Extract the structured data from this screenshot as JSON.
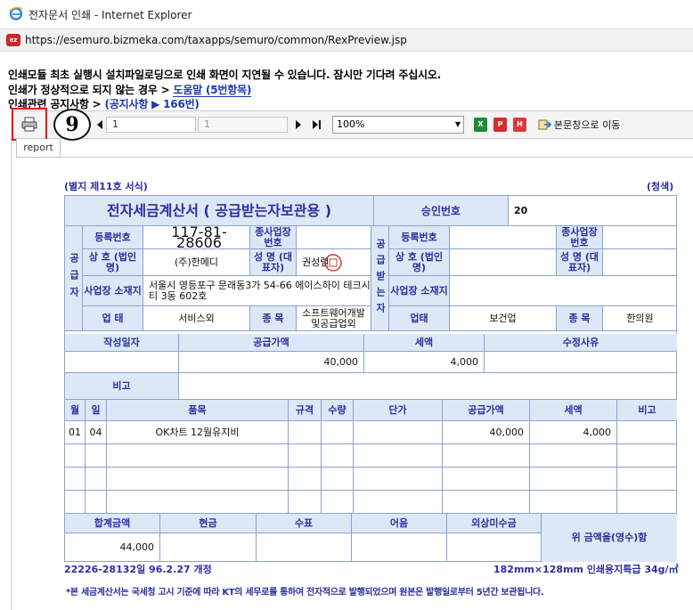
{
  "window": {
    "title": "전자문서 인쇄 - Internet Explorer",
    "url": "https://esemuro.bizmeka.com/taxapps/semuro/common/RexPreview.jsp"
  },
  "notices": {
    "line1": "인쇄모듈 최초 실행시 설치파일로딩으로 인쇄 화면이 지연될 수 있습니다. 잠시만 기다려 주십시오.",
    "line2_prefix": "인쇄가 정상적으로 되지 않는 경우 > ",
    "line2_link": "도움말 (5번항목)",
    "line3_prefix": "인쇄관련 공지사항 > ",
    "line3_link": "(공지사항 ▶ 166번)"
  },
  "toolbar": {
    "callout_number": "9",
    "current_page": "1",
    "total_pages": "1",
    "zoom": "100%",
    "goto_main_label": "본문창으로 이동",
    "icons": [
      "print-icon",
      "prev-page-icon",
      "next-page-icon",
      "last-page-icon",
      "excel-icon",
      "pdf-icon",
      "hwp-icon",
      "goto-main-icon"
    ]
  },
  "tab": {
    "label": "report"
  },
  "invoice": {
    "form_caption": "(별지 제11호 서식)",
    "copy_type": "(청색)",
    "title": "전자세금계산서 ( 공급받는자보관용 )",
    "approval_label": "승인번호",
    "approval_value": "20",
    "supplier_side_label": "공급자",
    "buyer_side_label": "공급받는자",
    "labels": {
      "reg_no": "등록번호",
      "branch_no": "종사업장 번호",
      "company": "상 호 (법인명)",
      "ceo": "성 명 (대표자)",
      "address": "사업장 소재지",
      "business_type": "업 태",
      "business_type_buyer": "업태",
      "item": "종 목"
    },
    "supplier": {
      "reg_no": "117-81-28606",
      "company": "(주)한메디",
      "ceo": "권성렬",
      "address": "서울시 영등포구 문래동3가 54-66 에이스하이 테크시티 3동 602호",
      "business_type": "서비스외",
      "item": "소프트웨어개발 및공급업외"
    },
    "buyer": {
      "business_type": "보건업",
      "item": "한의원"
    },
    "summary_headers": {
      "date": "작성일자",
      "supply_amount": "공급가액",
      "tax": "세액",
      "reason": "수정사유"
    },
    "summary": {
      "date": "",
      "supply_amount": "40,000",
      "tax": "4,000"
    },
    "remarks_label": "비고",
    "item_headers": {
      "month": "월",
      "day": "일",
      "name": "품목",
      "spec": "규격",
      "qty": "수량",
      "unit_price": "단가",
      "supply_amount": "공급가액",
      "tax": "세액",
      "note": "비고"
    },
    "items": [
      {
        "month": "01",
        "day": "04",
        "name": "OK차트 12월유지비",
        "supply_amount": "40,000",
        "tax": "4,000"
      }
    ],
    "total_headers": {
      "total": "합계금액",
      "cash": "현금",
      "check": "수표",
      "bill": "어음",
      "credit": "외상미수금"
    },
    "total": {
      "total": "44,000"
    },
    "receipt_text": "위 금액을(영수)함",
    "footer_left": "22226-28132일 96.2.27 개정",
    "footer_right": "182mm×128mm 인쇄용지특급 34g/㎡",
    "disclaimer": "*본 세금계산서는 국세청 고시 기준에 따라 KT의 세무로를 통하여 전자적으로 발행되었으며 원본은 발행일로부터 5년간 보관됩니다."
  },
  "colors": {
    "header_bg": "#dde8f6",
    "label_text": "#2b2fa0",
    "callout_border": "#ee1111",
    "border": "#8aa3cf"
  }
}
